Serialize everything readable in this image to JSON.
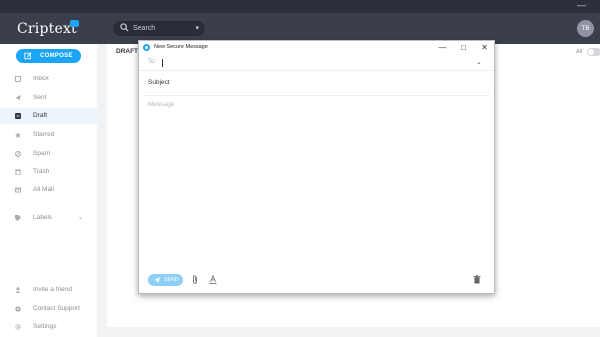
{
  "window": {
    "minimize": "—"
  },
  "app": {
    "logo": "Criptext"
  },
  "search": {
    "placeholder": "Search"
  },
  "user": {
    "initials": "TB"
  },
  "compose_button": {
    "label": "COMPOSE"
  },
  "sidebar": {
    "items": [
      {
        "label": "Inbox"
      },
      {
        "label": "Sent"
      },
      {
        "label": "Draft"
      },
      {
        "label": "Starred"
      },
      {
        "label": "Spam"
      },
      {
        "label": "Trash"
      },
      {
        "label": "All Mail"
      },
      {
        "label": "Labels"
      }
    ],
    "footer": [
      {
        "label": "Invite a friend"
      },
      {
        "label": "Contact Support"
      },
      {
        "label": "Settings"
      }
    ]
  },
  "main": {
    "title": "DRAFT",
    "filter_label": "All"
  },
  "compose_window": {
    "title": "New Secure Message",
    "minimize": "—",
    "maximize": "□",
    "close": "✕",
    "to_label": "To:",
    "subject": "Subject",
    "message_placeholder": "Message",
    "send_label": "SEND"
  },
  "colors": {
    "accent": "#1aa5f5",
    "topbar": "#3b3f4c",
    "send": "#8ecff8"
  }
}
